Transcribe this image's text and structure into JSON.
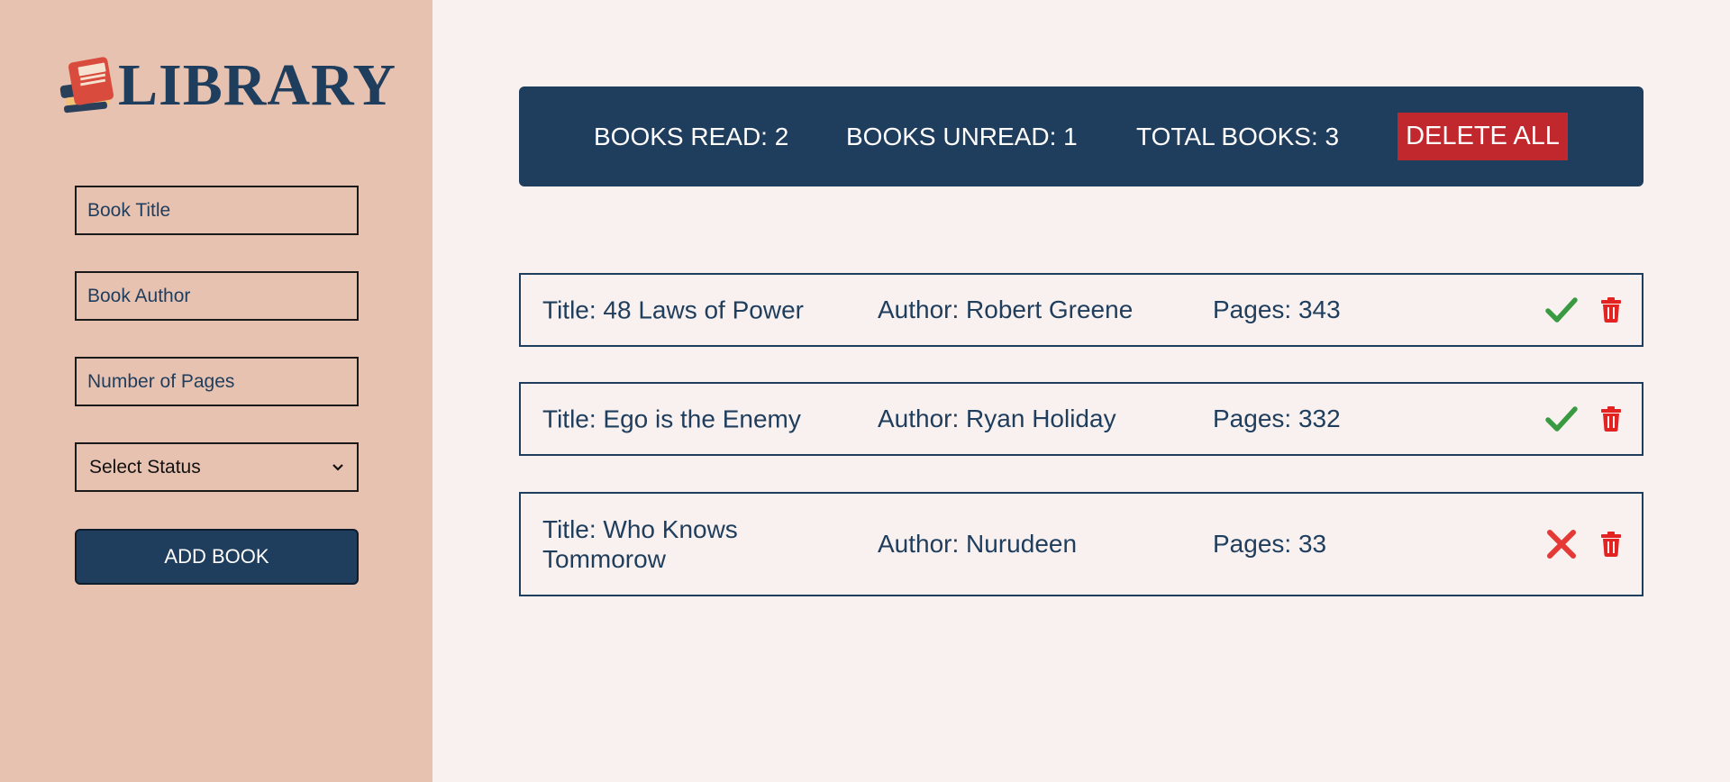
{
  "sidebar": {
    "logo_text": "LIBRARY",
    "logo_icon": "book-stack-icon",
    "inputs": {
      "title_placeholder": "Book Title",
      "author_placeholder": "Book Author",
      "pages_placeholder": "Number of Pages"
    },
    "status_select": {
      "selected": "Select Status"
    },
    "add_button_label": "ADD BOOK"
  },
  "stats": {
    "read_label": "BOOKS READ: 2",
    "unread_label": "BOOKS UNREAD: 1",
    "total_label": "TOTAL BOOKS: 3",
    "delete_all_label": "DELETE ALL"
  },
  "books": [
    {
      "title": "Title: 48 Laws of Power",
      "author": "Author: Robert Greene",
      "pages": "Pages: 343",
      "status_icon": "check-icon"
    },
    {
      "title": "Title: Ego is the Enemy",
      "author": "Author: Ryan Holiday",
      "pages": "Pages: 332",
      "status_icon": "check-icon"
    },
    {
      "title": "Title: Who Knows Tommorow",
      "author": "Author: Nurudeen",
      "pages": "Pages: 33",
      "status_icon": "cross-icon"
    }
  ],
  "colors": {
    "sidebar_bg": "#e8c2b0",
    "main_bg": "#f8f1ef",
    "navy": "#1f3d5c",
    "delete_red": "#c0282d",
    "check_green": "#3a9a41",
    "cross_red": "#e53935",
    "trash_red": "#e32222"
  }
}
